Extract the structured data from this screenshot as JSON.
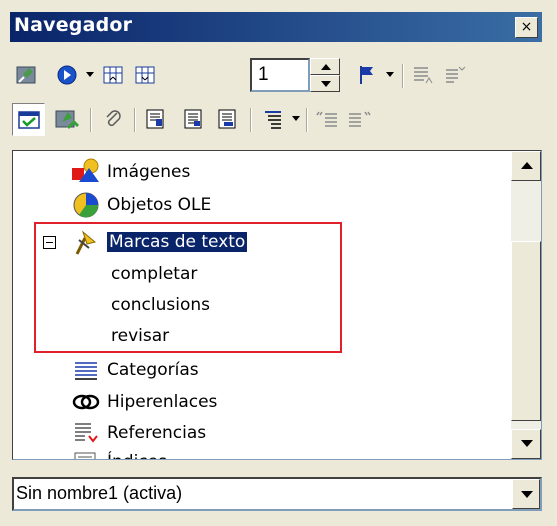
{
  "window": {
    "title": "Navegador",
    "close_glyph": "×"
  },
  "toolbar1": {
    "buttons": [
      {
        "name": "content-view-icon"
      },
      {
        "name": "navigation-icon"
      },
      {
        "name": "previous-icon"
      },
      {
        "name": "next-icon"
      },
      {
        "name": "flag-reminder-icon"
      },
      {
        "name": "header-list-icon"
      },
      {
        "name": "promote-chapter-icon"
      }
    ],
    "page_number": "1"
  },
  "toolbar2": {
    "buttons": [
      {
        "name": "list-box-toggle-icon"
      },
      {
        "name": "drag-mode-icon"
      },
      {
        "name": "attach-icon"
      },
      {
        "name": "heading-levels-icon"
      },
      {
        "name": "insert-header-icon"
      },
      {
        "name": "insert-footer-icon"
      },
      {
        "name": "outline-level-icon"
      },
      {
        "name": "promote-level-icon"
      },
      {
        "name": "demote-level-icon"
      }
    ]
  },
  "tree": {
    "items": [
      {
        "label": "Imágenes",
        "icon": "images-icon"
      },
      {
        "label": "Objetos OLE",
        "icon": "ole-objects-icon"
      },
      {
        "label": "Marcas de texto",
        "icon": "bookmark-icon",
        "selected": true,
        "expanded": true
      },
      {
        "label": "completar"
      },
      {
        "label": "conclusions"
      },
      {
        "label": "revisar"
      },
      {
        "label": "Categorías",
        "icon": "categories-icon"
      },
      {
        "label": "Hiperenlaces",
        "icon": "hyperlinks-icon"
      },
      {
        "label": "Referencias",
        "icon": "references-icon"
      },
      {
        "label": "Índices",
        "icon": "indexes-icon"
      }
    ]
  },
  "document_select": {
    "value": "Sin nombre1 (activa)"
  },
  "colors": {
    "titlebar": "#0a246a",
    "selection": "#0a246a",
    "highlight_box": "#e0202a",
    "face": "#ece9d8"
  }
}
